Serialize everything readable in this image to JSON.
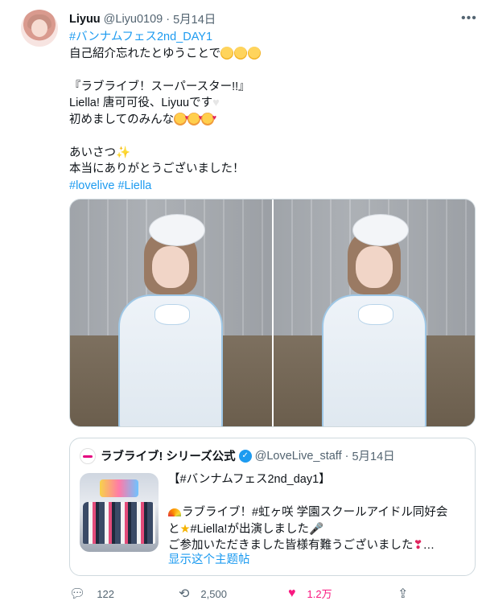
{
  "tweet": {
    "author": {
      "name": "Liyuu",
      "handle": "@Liyu0109",
      "separator": "·",
      "date": "5月14日"
    },
    "more_icon": "more-horizontal-icon",
    "text": {
      "hashtag_line": "#バンナムフェス2nd_DAY1",
      "line2": "自己紹介忘れたとゆうことで",
      "line4": "『ラブライブ！スーパースター!!』",
      "line5": "Liella! 唐可可役、Liyuuです",
      "line6": "初めましてのみんな",
      "line8": "あいさつ",
      "line9": "本当にありがとうございました！",
      "tags": [
        "#lovelive",
        "#Liella"
      ]
    },
    "photos": [
      {
        "description_icon": "photo-icon"
      },
      {
        "description_icon": "photo-icon"
      }
    ],
    "quote": {
      "name": "ラブライブ! シリーズ公式",
      "handle": "@LoveLive_staff",
      "separator": "·",
      "date": "5月14日",
      "verified_icon": "verified-badge-icon",
      "line1": "【#バンナムフェス2nd_day1】",
      "line3_a": "ラブライブ！#虹ヶ咲 学園スクールアイドル同好会",
      "line4_a": "と",
      "line4_b": "#Liella!が出演しました",
      "line5": "ご参加いただきました皆様有難うございました",
      "line5_end": "…",
      "show_thread": "显示这个主题帖"
    },
    "actions": {
      "reply_count": "122",
      "retweet_count": "2,500",
      "like_count": "1.2万",
      "share_label": ""
    },
    "colors": {
      "link": "#1d9bf0",
      "like": "#f91880",
      "muted": "#536471"
    }
  }
}
